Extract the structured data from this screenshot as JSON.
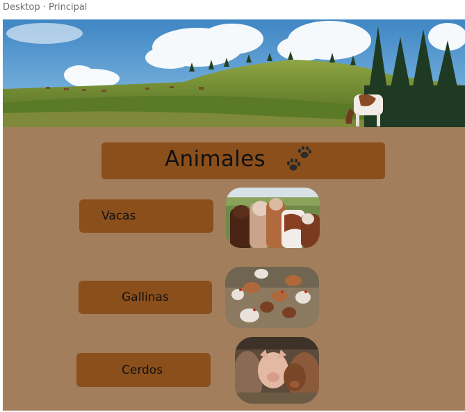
{
  "frame_label": "Desktop · Principal",
  "header": {
    "title": "Animales",
    "icon": "paw-prints-icon"
  },
  "animals": [
    {
      "label": "Vacas",
      "image": "cows-photo"
    },
    {
      "label": "Gallinas",
      "image": "chickens-photo"
    },
    {
      "label": "Cerdos",
      "image": "pigs-photo"
    }
  ],
  "colors": {
    "background": "#a37e5c",
    "button": "#8b4f1c",
    "text": "#111111"
  }
}
